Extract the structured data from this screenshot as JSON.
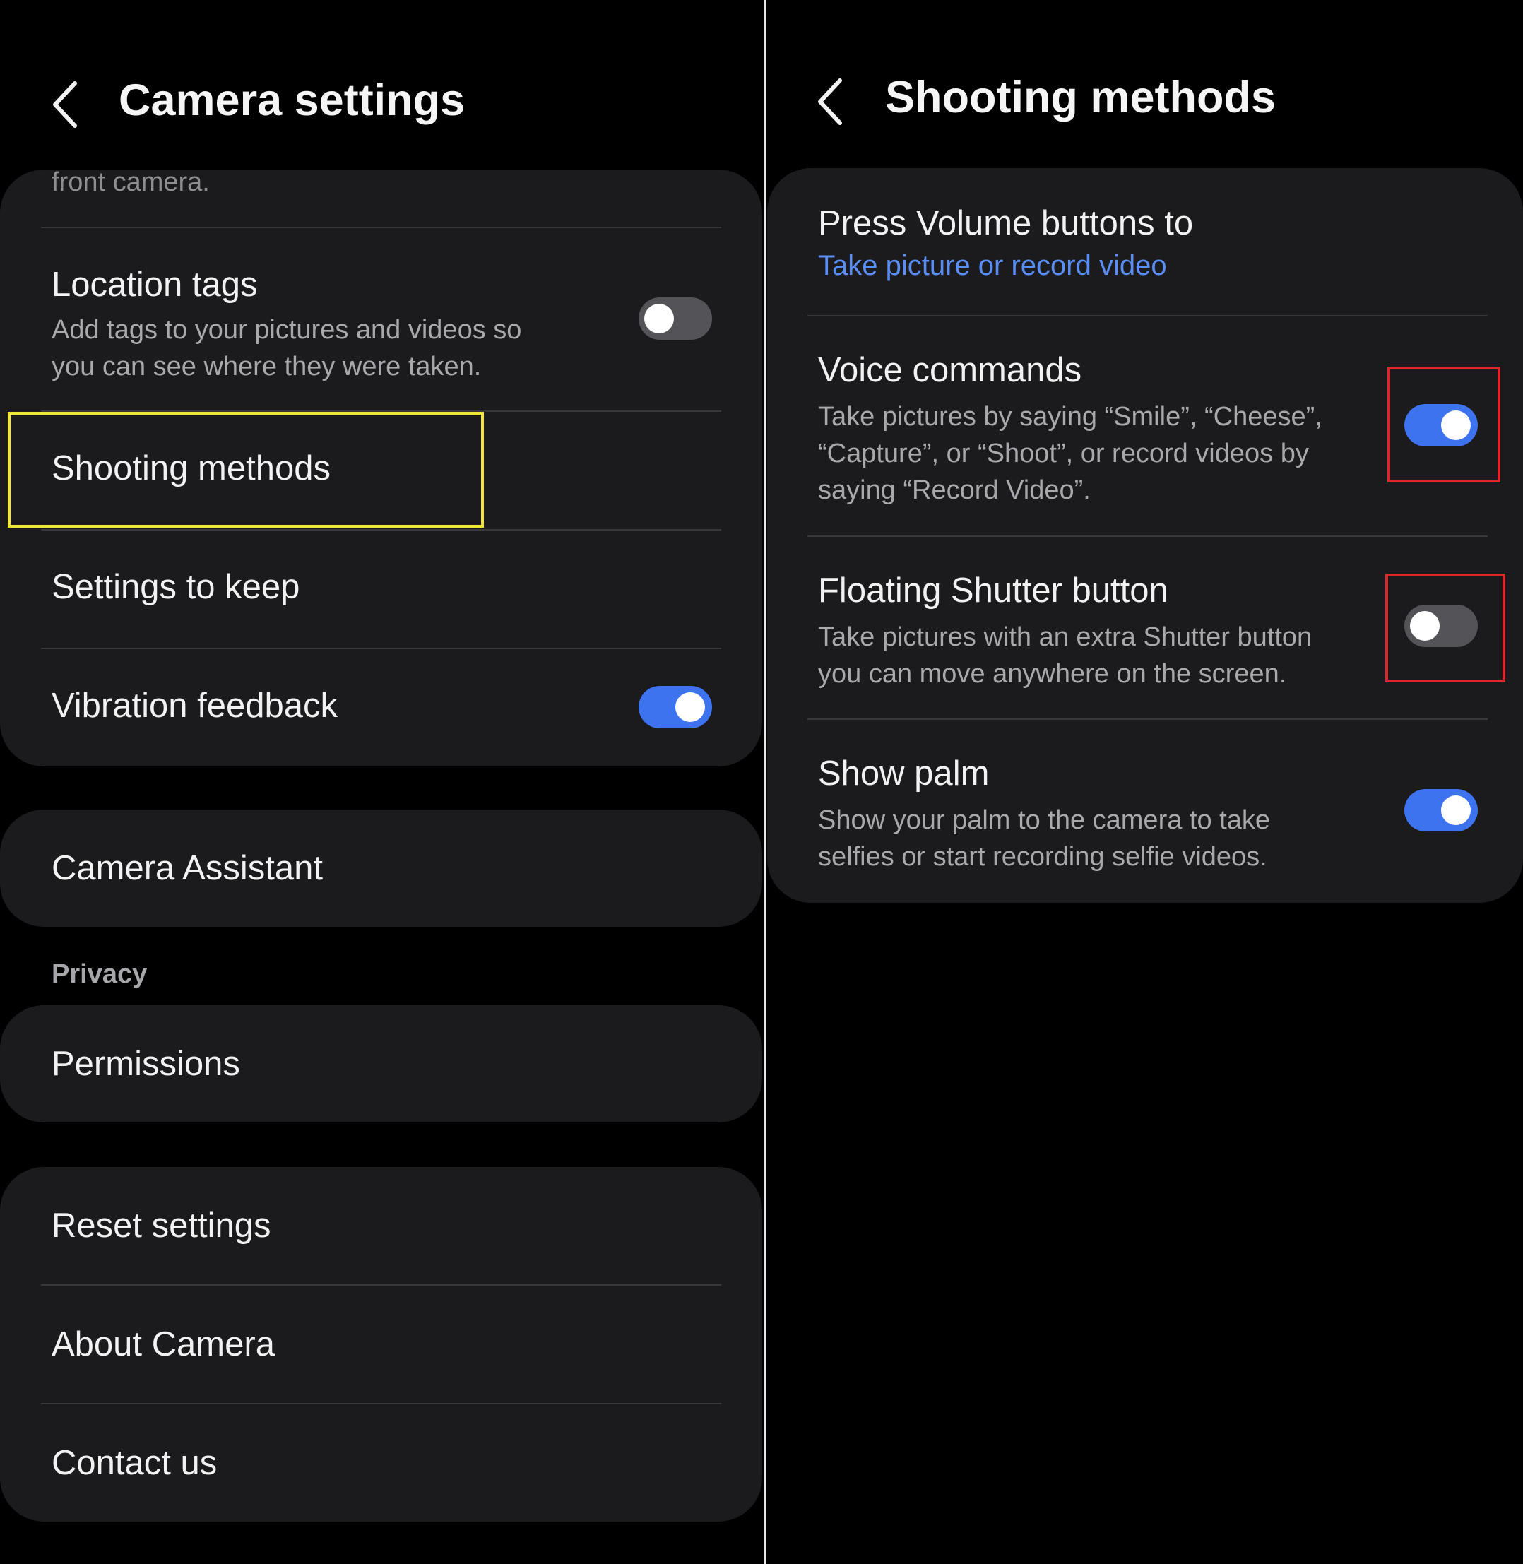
{
  "left": {
    "title": "Camera settings",
    "partial_text": "front camera.",
    "location_tags": {
      "label": "Location tags",
      "desc_line1": "Add tags to your pictures and videos so",
      "desc_line2": "you can see where they were taken.",
      "enabled": false
    },
    "shooting_methods": {
      "label": "Shooting methods"
    },
    "settings_to_keep": {
      "label": "Settings to keep"
    },
    "vibration_feedback": {
      "label": "Vibration feedback",
      "enabled": true
    },
    "camera_assistant": {
      "label": "Camera Assistant"
    },
    "privacy_header": "Privacy",
    "permissions": {
      "label": "Permissions"
    },
    "reset_settings": {
      "label": "Reset settings"
    },
    "about_camera": {
      "label": "About Camera"
    },
    "contact_us": {
      "label": "Contact us"
    }
  },
  "right": {
    "title": "Shooting methods",
    "press_volume": {
      "label": "Press Volume buttons to",
      "value": "Take picture or record video"
    },
    "voice_commands": {
      "label": "Voice commands",
      "desc_line1": "Take pictures by saying “Smile”, “Cheese”,",
      "desc_line2": "“Capture”, or “Shoot”, or record videos by",
      "desc_line3": "saying “Record Video”.",
      "enabled": true
    },
    "floating_shutter": {
      "label": "Floating Shutter button",
      "desc_line1": "Take pictures with an extra Shutter button",
      "desc_line2": "you can move anywhere on the screen.",
      "enabled": false
    },
    "show_palm": {
      "label": "Show palm",
      "desc_line1": "Show your palm to the camera to take",
      "desc_line2": "selfies or start recording selfie videos.",
      "enabled": true
    }
  },
  "icons": {
    "back": "chevron-left-icon"
  },
  "colors": {
    "background": "#000000",
    "card": "#1b1b1d",
    "toggle_on": "#3e73f0",
    "toggle_off": "#545458",
    "link": "#5b8ef5",
    "highlight_yellow": "#f2e53a",
    "highlight_red": "#e0252c"
  }
}
